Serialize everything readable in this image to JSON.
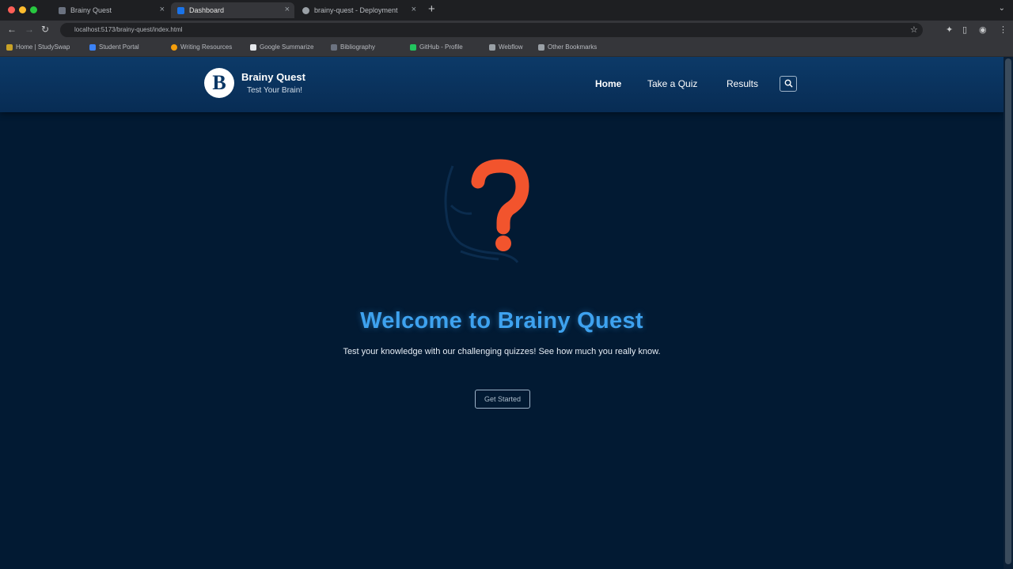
{
  "browser": {
    "tabs": [
      {
        "title": "Brainy Quest"
      },
      {
        "title": "Dashboard"
      },
      {
        "title": "brainy-quest - Deployment"
      }
    ],
    "new_tab_label": "+",
    "address": "localhost:5173/brainy-quest/index.html",
    "bookmarks": [
      {
        "label": "Home | StudySwap"
      },
      {
        "label": "Student Portal"
      },
      {
        "label": "Writing Resources"
      },
      {
        "label": "Google Summarize"
      },
      {
        "label": "Bibliography"
      },
      {
        "label": "GitHub - Profile"
      },
      {
        "label": "Webflow"
      },
      {
        "label": "Other Bookmarks"
      }
    ]
  },
  "header": {
    "logo_letter": "B",
    "title": "Brainy Quest",
    "tagline": "Test Your Brain!"
  },
  "nav": {
    "home": "Home",
    "take_quiz": "Take a Quiz",
    "results": "Results"
  },
  "icons": {
    "search": "search-icon",
    "question": "question-mark-icon"
  },
  "hero": {
    "title": "Welcome to Brainy Quest",
    "subtitle": "Test your knowledge with our challenging quizzes! See how much you really know.",
    "cta": "Get Started"
  },
  "colors": {
    "page_bg": "#021a33",
    "header_bg": "#0b3765",
    "accent_blue": "#3ea2ef",
    "question_orange": "#f2542d"
  }
}
